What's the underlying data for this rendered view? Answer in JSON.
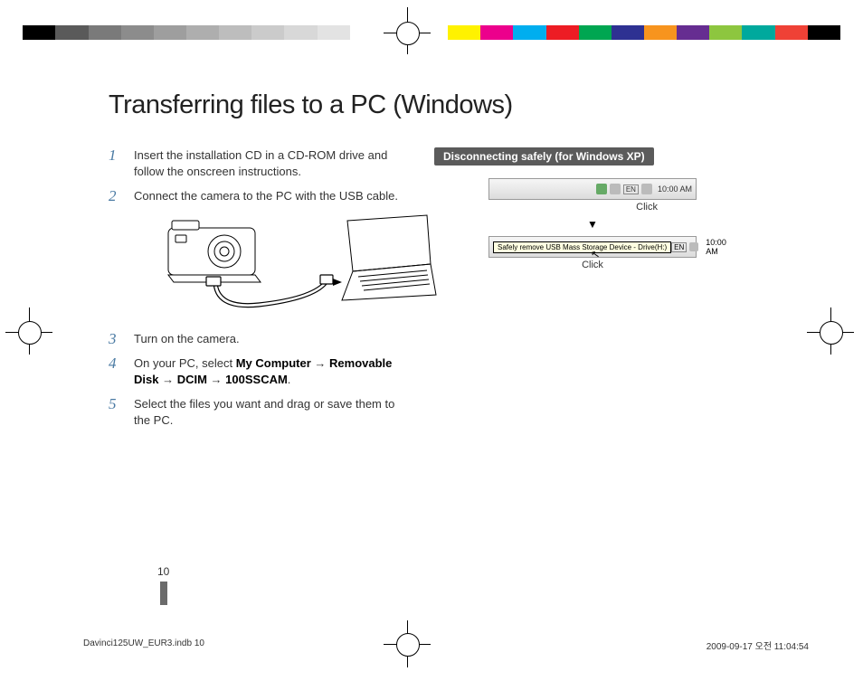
{
  "header": {
    "title": "Transferring files to a PC (Windows)"
  },
  "steps": {
    "s1": "Insert the installation CD in a CD-ROM drive and follow the onscreen instructions.",
    "s2": "Connect the camera to the PC with the USB cable.",
    "s3": "Turn on the camera.",
    "s4_pre": "On your PC, select ",
    "s4_b1": "My Computer",
    "s4_b2": "Removable Disk",
    "s4_b3": "DCIM",
    "s4_b4": "100SSCAM",
    "s5": "Select the files you want and drag or save them to the PC."
  },
  "right": {
    "subhead": "Disconnecting safely (for Windows XP)",
    "taskbar_en": "EN",
    "taskbar_time": "10:00 AM",
    "click1": "Click",
    "arrow": "▼",
    "tooltip": "Safely remove USB Mass Storage Device - Drive(H:)",
    "click2": "Click"
  },
  "page": {
    "number": "10"
  },
  "footer": {
    "file": "Davinci125UW_EUR3.indb   10",
    "timestamp": "2009-09-17   오전 11:04:54"
  },
  "colorbar": [
    "#000000",
    "#5a5a5a",
    "#7a7a7a",
    "#8c8c8c",
    "#9e9e9e",
    "#aeaeae",
    "#bdbdbd",
    "#cbcbcb",
    "#d8d8d8",
    "#e3e3e3",
    "#fff",
    "#fff200",
    "#ec008c",
    "#00aeef",
    "#ed1c24",
    "#00a651",
    "#2e3192",
    "#f7941e",
    "#662d91",
    "#8dc63f",
    "#00a99d",
    "#ef4136",
    "#000000"
  ]
}
